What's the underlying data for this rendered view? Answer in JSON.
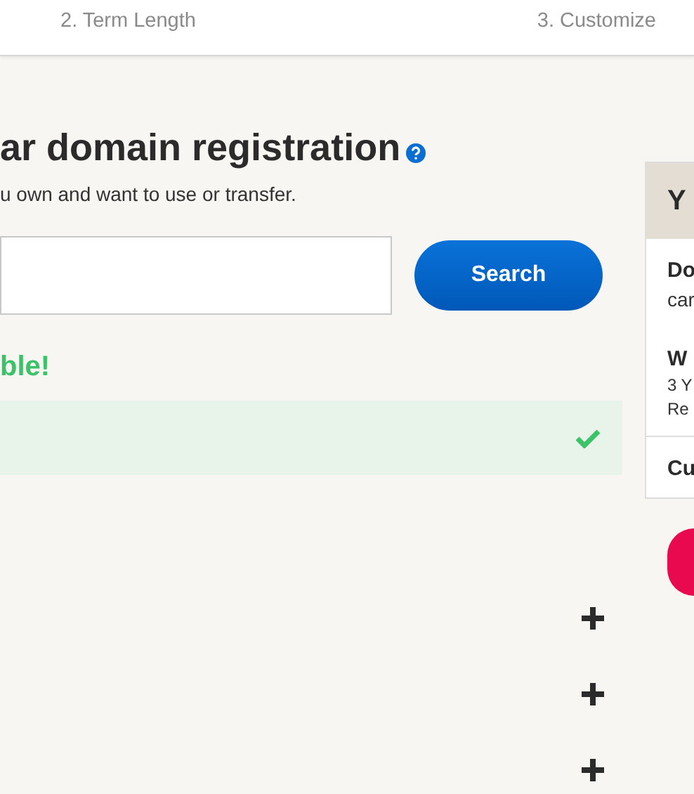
{
  "steps": [
    {
      "label": "2. Term Length"
    },
    {
      "label": "3. Customize"
    }
  ],
  "heading": "ar domain registration",
  "subtitle": "u own and want to use or transfer.",
  "search": {
    "button": "Search"
  },
  "result": {
    "message": "ble!",
    "available": true
  },
  "options": [
    {
      "expanded": false
    },
    {
      "expanded": false
    },
    {
      "expanded": false
    }
  ],
  "summary": {
    "title": "Y",
    "sections": [
      {
        "heading": "Do",
        "lines": [
          "car"
        ]
      },
      {
        "heading": "W",
        "lines": [
          "3 Y",
          "Re"
        ]
      },
      {
        "heading": "Cu"
      }
    ]
  }
}
